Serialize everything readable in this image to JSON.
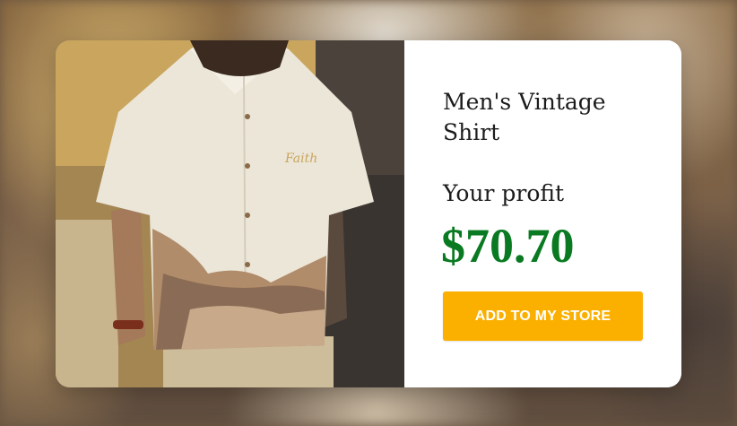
{
  "product": {
    "title": "Men's Vintage Shirt",
    "image_alt": "Man wearing a cream short-sleeve vintage shirt with desert print"
  },
  "profit": {
    "label": "Your profit",
    "amount": "$70.70"
  },
  "cta": {
    "label": "ADD TO MY STORE"
  },
  "colors": {
    "price": "#0a7a22",
    "button": "#fbb000",
    "button_text": "#ffffff",
    "card": "#ffffff"
  }
}
